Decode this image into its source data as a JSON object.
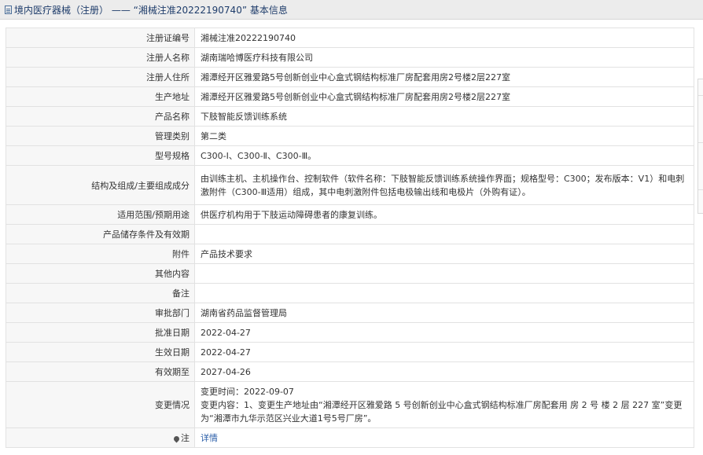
{
  "header": {
    "title": "境内医疗器械（注册） —— “湘械注准20222190740” 基本信息"
  },
  "rows": [
    {
      "label": "注册证编号",
      "value": "湘械注准20222190740"
    },
    {
      "label": "注册人名称",
      "value": "湖南瑞哈博医疗科技有限公司"
    },
    {
      "label": "注册人住所",
      "value": "湘潭经开区雅爱路5号创新创业中心盒式钢结构标准厂房配套用房2号楼2层227室"
    },
    {
      "label": "生产地址",
      "value": "湘潭经开区雅爱路5号创新创业中心盒式钢结构标准厂房配套用房2号楼2层227室"
    },
    {
      "label": "产品名称",
      "value": "下肢智能反馈训练系统"
    },
    {
      "label": "管理类别",
      "value": "第二类"
    },
    {
      "label": "型号规格",
      "value": "C300-Ⅰ、C300-Ⅱ、C300-Ⅲ。"
    },
    {
      "label": "结构及组成/主要组成成分",
      "value": "由训练主机、主机操作台、控制软件（软件名称：下肢智能反馈训练系统操作界面；规格型号：C300；发布版本：V1）和电刺激附件（C300-Ⅲ适用）组成，其中电刺激附件包括电极输出线和电极片（外购有证）。"
    },
    {
      "label": "适用范围/预期用途",
      "value": "供医疗机构用于下肢运动障碍患者的康复训练。"
    },
    {
      "label": "产品储存条件及有效期",
      "value": ""
    },
    {
      "label": "附件",
      "value": "产品技术要求"
    },
    {
      "label": "其他内容",
      "value": ""
    },
    {
      "label": "备注",
      "value": ""
    },
    {
      "label": "审批部门",
      "value": "湖南省药品监督管理局"
    },
    {
      "label": "批准日期",
      "value": "2022-04-27"
    },
    {
      "label": "生效日期",
      "value": "2022-04-27"
    },
    {
      "label": "有效期至",
      "value": "2027-04-26"
    }
  ],
  "change": {
    "label": "变更情况",
    "time": "变更时间：2022-09-07",
    "content": "变更内容：1、变更生产地址由“湘潭经开区雅爱路 5 号创新创业中心盒式钢结构标准厂房配套用 房 2 号 楼 2 层 227 室”变更为“湘潭市九华示范区兴业大道1号5号厂房”。"
  },
  "note": {
    "label": "注",
    "link": "详情",
    "icon": "pin-icon"
  }
}
